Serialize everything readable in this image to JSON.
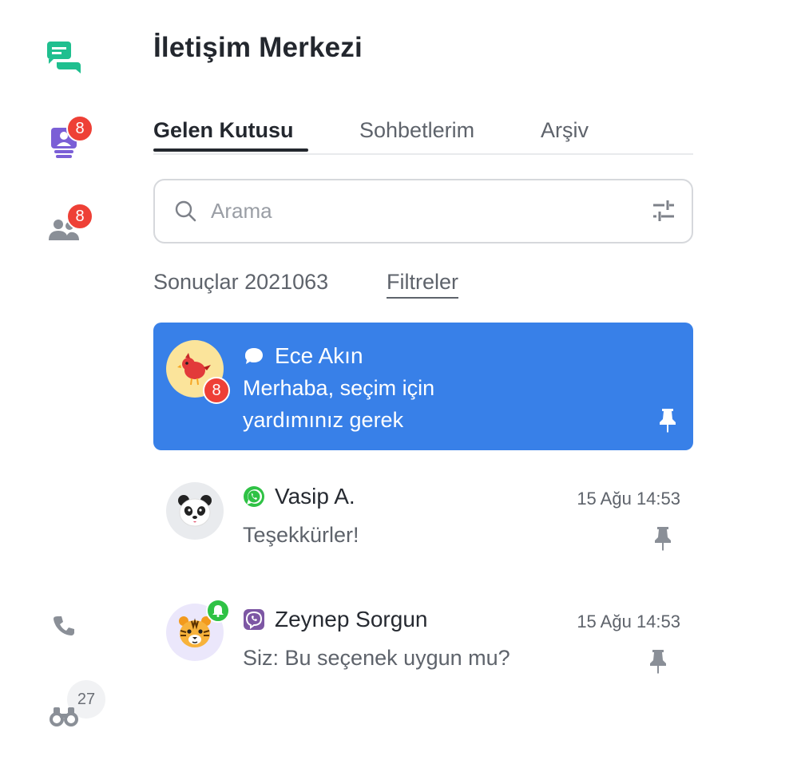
{
  "app": {
    "title": "İletişim Merkezi"
  },
  "rail": {
    "icons": [
      "chat-bubbles-icon",
      "contact-card-icon",
      "users-icon",
      "phone-icon",
      "binoculars-icon"
    ],
    "badges": {
      "contacts": "8",
      "users": "8",
      "watch": "27"
    },
    "accent": "#1fbf8f"
  },
  "tabs": [
    {
      "label": "Gelen Kutusu",
      "active": true
    },
    {
      "label": "Sohbetlerim",
      "active": false
    },
    {
      "label": "Arşiv",
      "active": false
    }
  ],
  "search": {
    "placeholder": "Arama",
    "value": ""
  },
  "results": {
    "label": "Sonuçlar 2021063",
    "filters_label": "Filtreler"
  },
  "conversations": [
    {
      "name": "Ece Akın",
      "channel": "chat-bubble-icon",
      "message_line1": "Merhaba, seçim için",
      "message_line2": "yardımınız gerek",
      "time": "",
      "unread": "8",
      "avatar": "bird-avatar",
      "active": true
    },
    {
      "name": "Vasip A.",
      "channel": "whatsapp-icon",
      "message_line1": "Teşekkürler!",
      "time": "15 Ağu 14:53",
      "avatar": "panda-avatar",
      "active": false
    },
    {
      "name": "Zeynep Sorgun",
      "channel": "viber-icon",
      "message_line1": "Siz: Bu seçenek uygun mu?",
      "time": "15 Ağu 14:53",
      "avatar": "tiger-avatar",
      "active": false
    }
  ],
  "colors": {
    "active_row": "#3880e8",
    "badge_red": "#ee4036",
    "whatsapp": "#2fc245",
    "viber": "#7d57a4",
    "rail_purple": "#7b5fd6"
  }
}
